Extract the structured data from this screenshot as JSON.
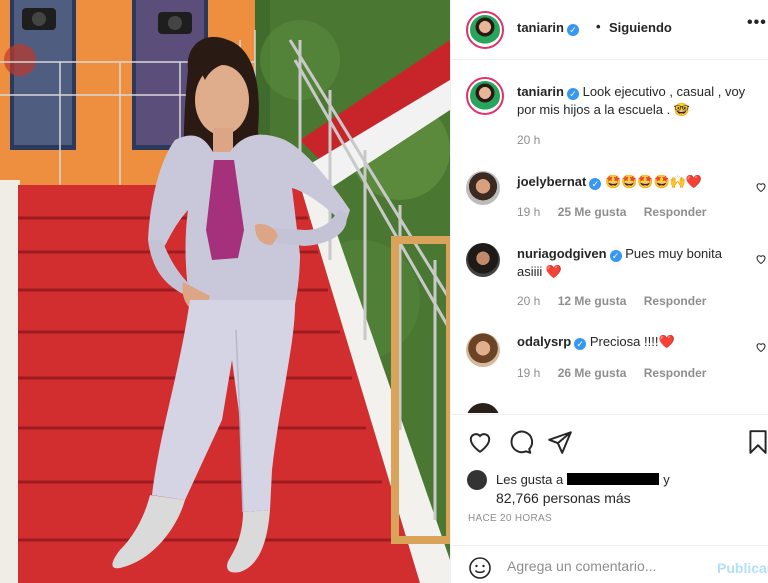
{
  "post": {
    "author": "taniarin",
    "follow_status": "Siguiendo",
    "separator": "•",
    "more_label": "•••"
  },
  "caption": {
    "user": "taniarin",
    "text": "Look ejecutivo , casual , voy por mis hijos a la escuela . 🤓",
    "time": "20 h"
  },
  "comments": [
    {
      "user": "joelybernat",
      "text": "🤩🤩🤩🤩🙌❤️",
      "time": "19 h",
      "likes": "25 Me gusta",
      "reply": "Responder"
    },
    {
      "user": "nuriagodgiven",
      "text": "Pues muy bonita asiiii ❤️",
      "time": "20 h",
      "likes": "12 Me gusta",
      "reply": "Responder"
    },
    {
      "user": "odalysrp",
      "text": "Preciosa !!!!❤️",
      "time": "19 h",
      "likes": "26 Me gusta",
      "reply": "Responder"
    }
  ],
  "likes": {
    "prefix": "Les gusta a",
    "suffix": "y",
    "count_line": "82,766 personas más"
  },
  "timestamp": "HACE 20 HORAS",
  "composer": {
    "placeholder": "Agrega un comentario...",
    "publish_label": "Publicar"
  },
  "colors": {
    "verified": "#3897f0",
    "story_ring": "#e1306c",
    "publish_disabled": "#b2dffc",
    "heart_red": "#ed4956"
  }
}
